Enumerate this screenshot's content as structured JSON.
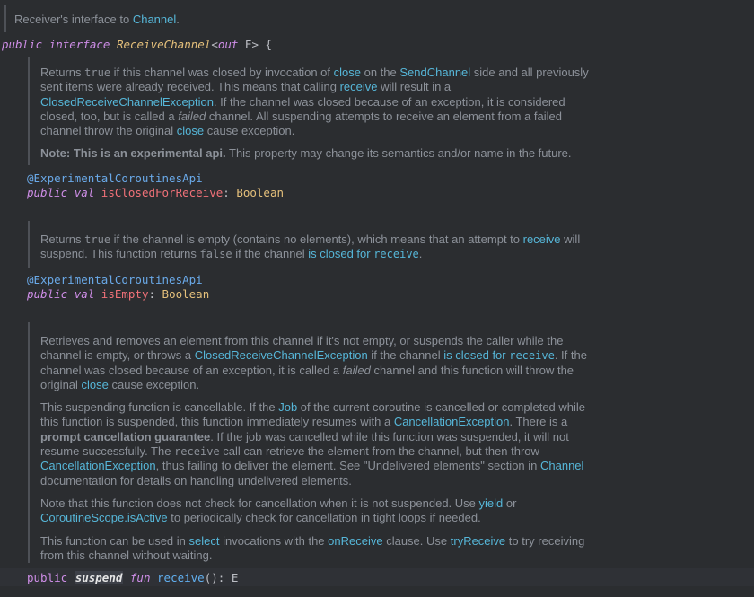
{
  "top_doc": {
    "prefix": "Receiver's interface to ",
    "link": "Channel",
    "suffix": "."
  },
  "decl": {
    "public": "public",
    "interface": "interface",
    "name": "ReceiveChannel",
    "lt": "<",
    "out": "out",
    "e": " E",
    "rest": "> {"
  },
  "doc1": {
    "p1": [
      "Returns ",
      "true",
      " if this channel was closed by invocation of ",
      "close",
      " on the ",
      "SendChannel",
      " side and all previously sent items were already received. This means that calling ",
      "receive",
      " will result in a ",
      "ClosedReceiveChannelException",
      ". If the channel was closed because of an exception, it is considered closed, too, but is called a ",
      "failed",
      " channel. All suspending attempts to receive an element from a failed channel throw the original ",
      "close",
      " cause exception."
    ],
    "note_bold": "Note: This is an experimental api.",
    "note_rest": " This property may change its semantics and/or name in the future."
  },
  "sig1": {
    "annotation": "@ExperimentalCoroutinesApi",
    "public": "public",
    "val": "val",
    "name": "isClosedForReceive",
    "colon": ": ",
    "type": "Boolean"
  },
  "doc2": {
    "p1": [
      "Returns ",
      "true",
      " if the channel is empty (contains no elements), which means that an attempt to ",
      "receive",
      " will suspend. This function returns ",
      "false",
      " if the channel ",
      "is closed for ",
      "receive",
      "."
    ]
  },
  "sig2": {
    "annotation": "@ExperimentalCoroutinesApi",
    "public": "public",
    "val": "val",
    "name": "isEmpty",
    "colon": ": ",
    "type": "Boolean"
  },
  "doc3": {
    "p1": [
      "Retrieves and removes an element from this channel if it's not empty, or suspends the caller while the channel is empty, or throws a ",
      "ClosedReceiveChannelException",
      " if the channel ",
      "is closed for ",
      "receive",
      ". If the channel was closed because of an exception, it is called a ",
      "failed",
      " channel and this function will throw the original ",
      "close",
      " cause exception."
    ],
    "p2": [
      "This suspending function is cancellable. If the ",
      "Job",
      " of the current coroutine is cancelled or completed while this function is suspended, this function immediately resumes with a ",
      "CancellationException",
      ". There is a ",
      "prompt cancellation guarantee",
      ". If the job was cancelled while this function was suspended, it will not resume successfully. The ",
      "receive",
      " call can retrieve the element from the channel, but then throw ",
      "CancellationException",
      ", thus failing to deliver the element. See \"Undelivered elements\" section in ",
      "Channel",
      " documentation for details on handling undelivered elements."
    ],
    "p3": [
      "Note that this function does not check for cancellation when it is not suspended. Use ",
      "yield",
      " or ",
      "CoroutineScope.isActive",
      " to periodically check for cancellation in tight loops if needed."
    ],
    "p4": [
      "This function can be used in ",
      "select",
      " invocations with the ",
      "onReceive",
      " clause. Use ",
      "tryReceive",
      " to try receiving from this channel without waiting."
    ]
  },
  "sig3": {
    "public": "public",
    "suspend": "suspend",
    "fun": "fun",
    "name": "receive",
    "parens": "()",
    "colon": ": ",
    "type": "E"
  }
}
